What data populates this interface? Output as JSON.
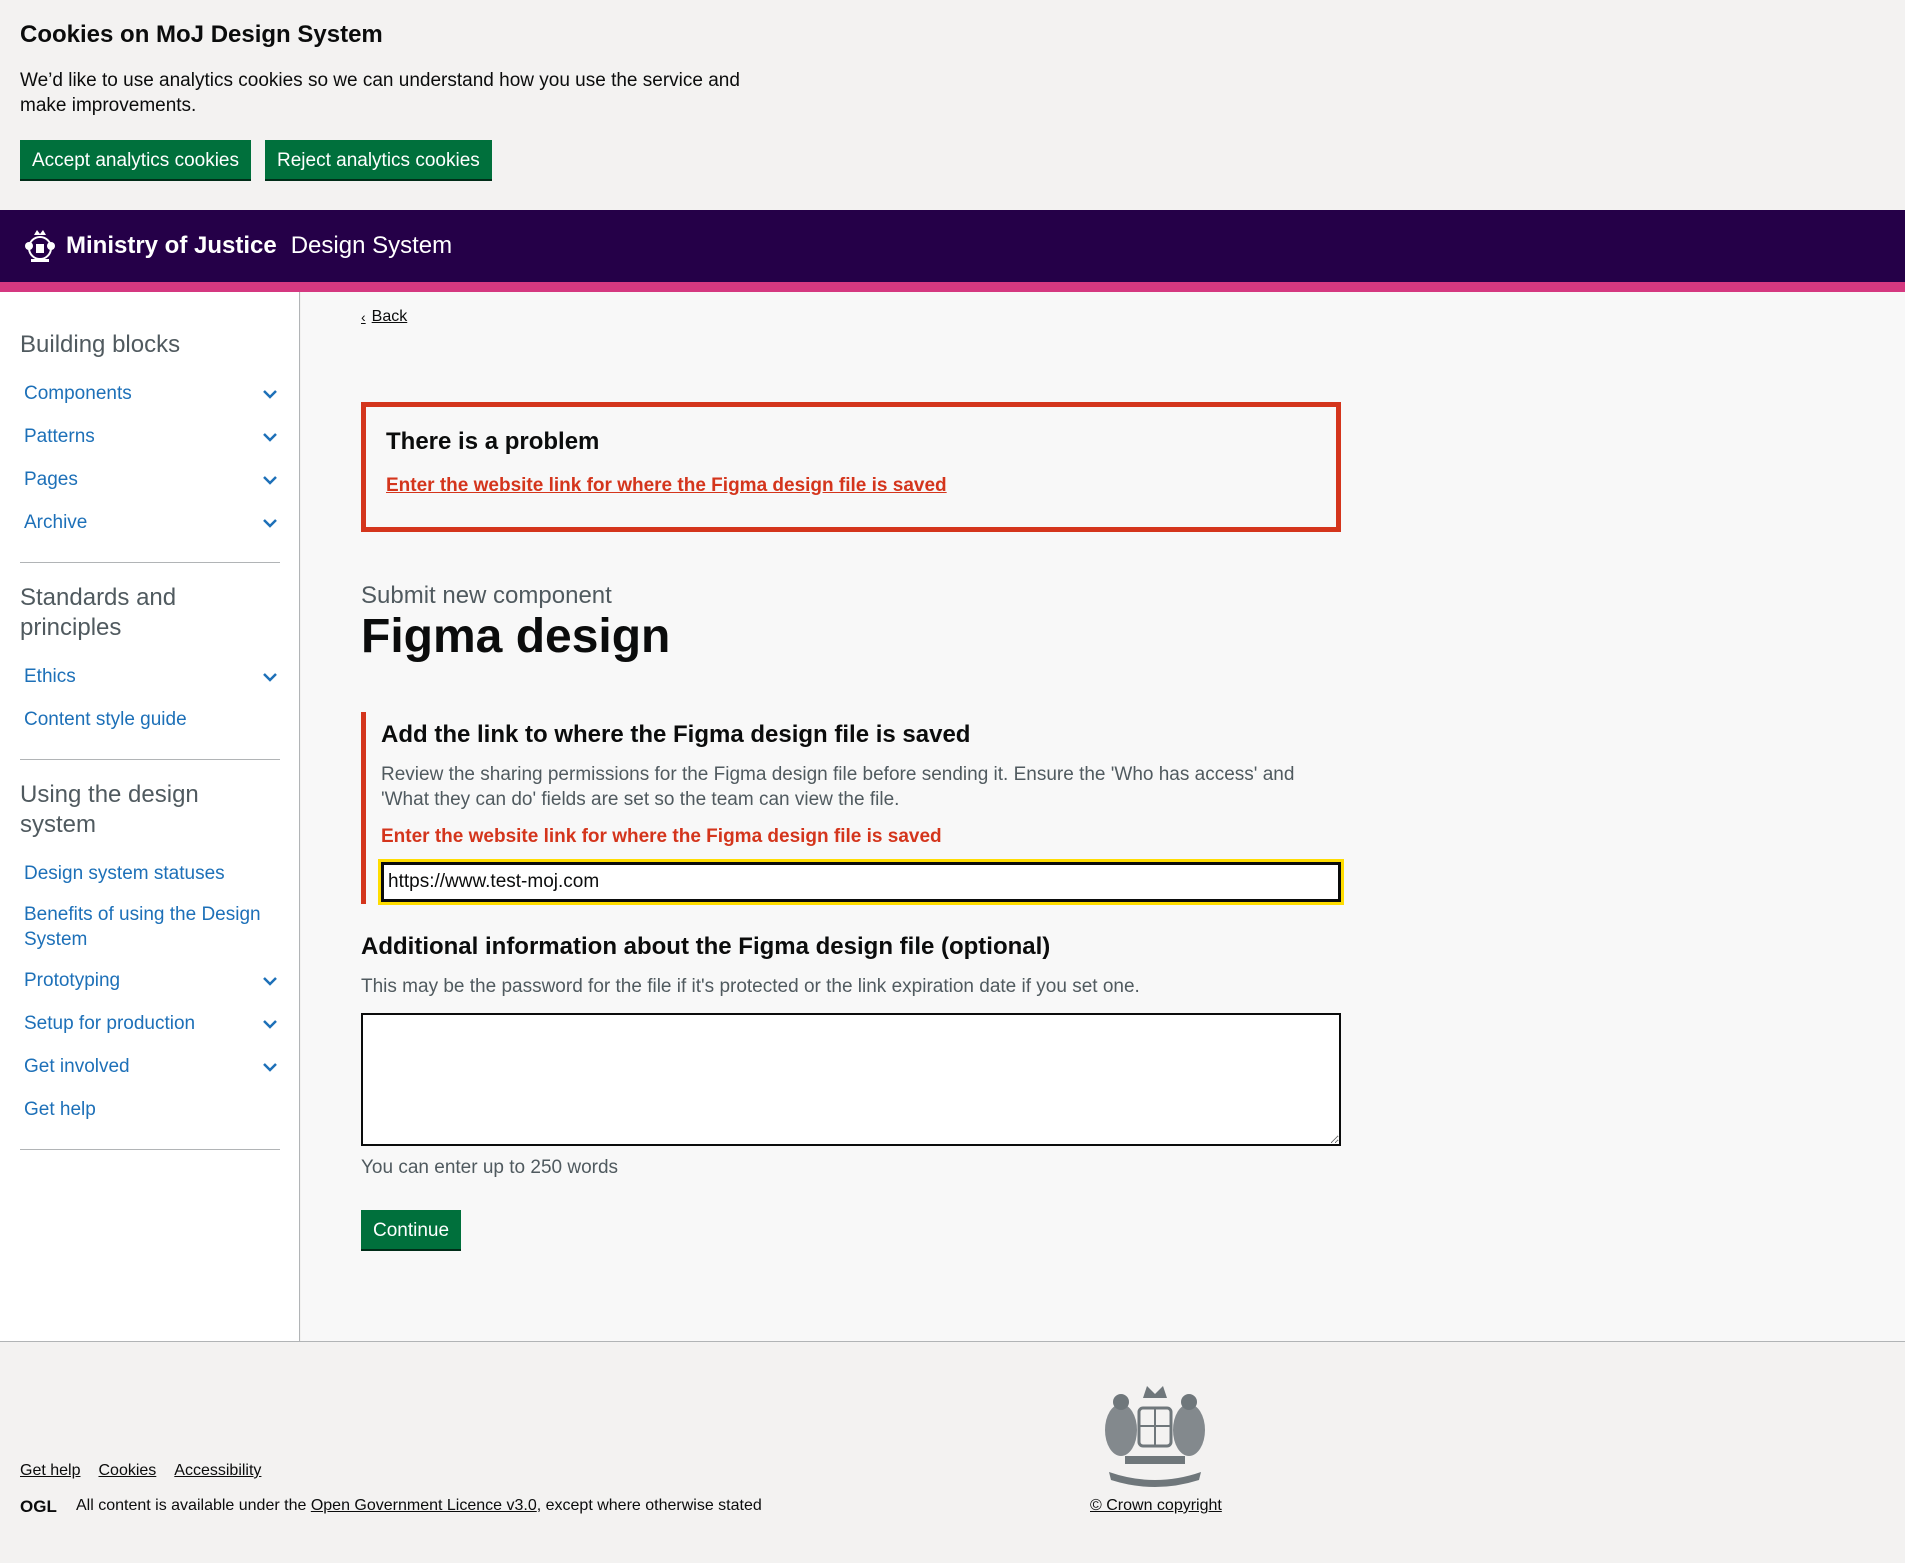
{
  "cookie_banner": {
    "heading": "Cookies on MoJ Design System",
    "body": "We’d like to use analytics cookies so we can understand how you use the service and make improvements.",
    "accept_label": "Accept analytics cookies",
    "reject_label": "Reject analytics cookies"
  },
  "header": {
    "org": "Ministry of Justice",
    "service": "Design System"
  },
  "sidebar": {
    "sections": [
      {
        "heading": "Building blocks",
        "items": [
          {
            "label": "Components",
            "expandable": true
          },
          {
            "label": "Patterns",
            "expandable": true
          },
          {
            "label": "Pages",
            "expandable": true
          },
          {
            "label": "Archive",
            "expandable": true
          }
        ]
      },
      {
        "heading": "Standards and principles",
        "items": [
          {
            "label": "Ethics",
            "expandable": true
          },
          {
            "label": "Content style guide",
            "expandable": false
          }
        ]
      },
      {
        "heading": "Using the design system",
        "items": [
          {
            "label": "Design system statuses",
            "expandable": false
          },
          {
            "label": "Benefits of using the Design System",
            "expandable": false
          },
          {
            "label": "Prototyping",
            "expandable": true
          },
          {
            "label": "Setup for production",
            "expandable": true
          },
          {
            "label": "Get involved",
            "expandable": true
          },
          {
            "label": "Get help",
            "expandable": false
          }
        ]
      }
    ]
  },
  "main": {
    "back_label": "Back",
    "error_summary": {
      "title": "There is a problem",
      "link": "Enter the website link for where the Figma design file is saved"
    },
    "caption": "Submit new component",
    "title": "Figma design",
    "link_field": {
      "label": "Add the link to where the Figma design file is saved",
      "hint": "Review the sharing permissions for the Figma design file before sending it. Ensure the 'Who has access' and 'What they can do' fields are set so the team can view the file.",
      "error": "Enter the website link for where the Figma design file is saved",
      "value": "https://www.test-moj.com"
    },
    "info_field": {
      "label": "Additional information about the Figma design file (optional)",
      "hint": "This may be the password for the file if it's protected or the link expiration date if you set one.",
      "value": "",
      "count_message": "You can enter up to 250 words"
    },
    "continue_label": "Continue"
  },
  "footer": {
    "links": [
      "Get help",
      "Cookies",
      "Accessibility"
    ],
    "licence_prefix": "All content is available under the",
    "licence_link": "Open Government Licence v3.0",
    "licence_suffix": ", except where otherwise stated",
    "crown_copyright": "© Crown copyright"
  },
  "colors": {
    "header_bg": "#250048",
    "header_accent": "#d53880",
    "button_green": "#00703c",
    "error_red": "#d4351c",
    "link_blue": "#1d70b8",
    "focus_yellow": "#ffdd00"
  }
}
